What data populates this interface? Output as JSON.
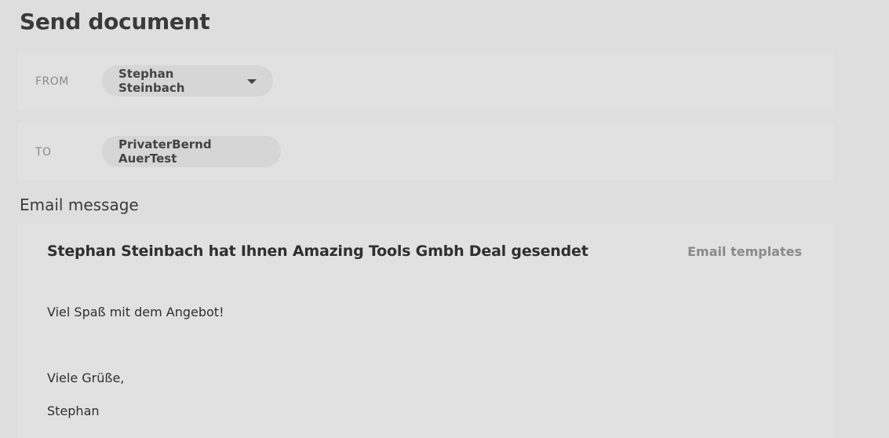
{
  "page": {
    "title": "Send document"
  },
  "from": {
    "label": "FROM",
    "sender": "Stephan Steinbach"
  },
  "to": {
    "label": "TO",
    "recipient": "PrivaterBernd AuerTest"
  },
  "email": {
    "section_title": "Email message",
    "subject": "Stephan Steinbach hat Ihnen Amazing Tools Gmbh Deal gesendet",
    "templates_link": "Email templates",
    "body_line_1": "Viel Spaß mit dem Angebot!",
    "body_line_2": "Viele Grüße,",
    "body_line_3": "Stephan"
  }
}
